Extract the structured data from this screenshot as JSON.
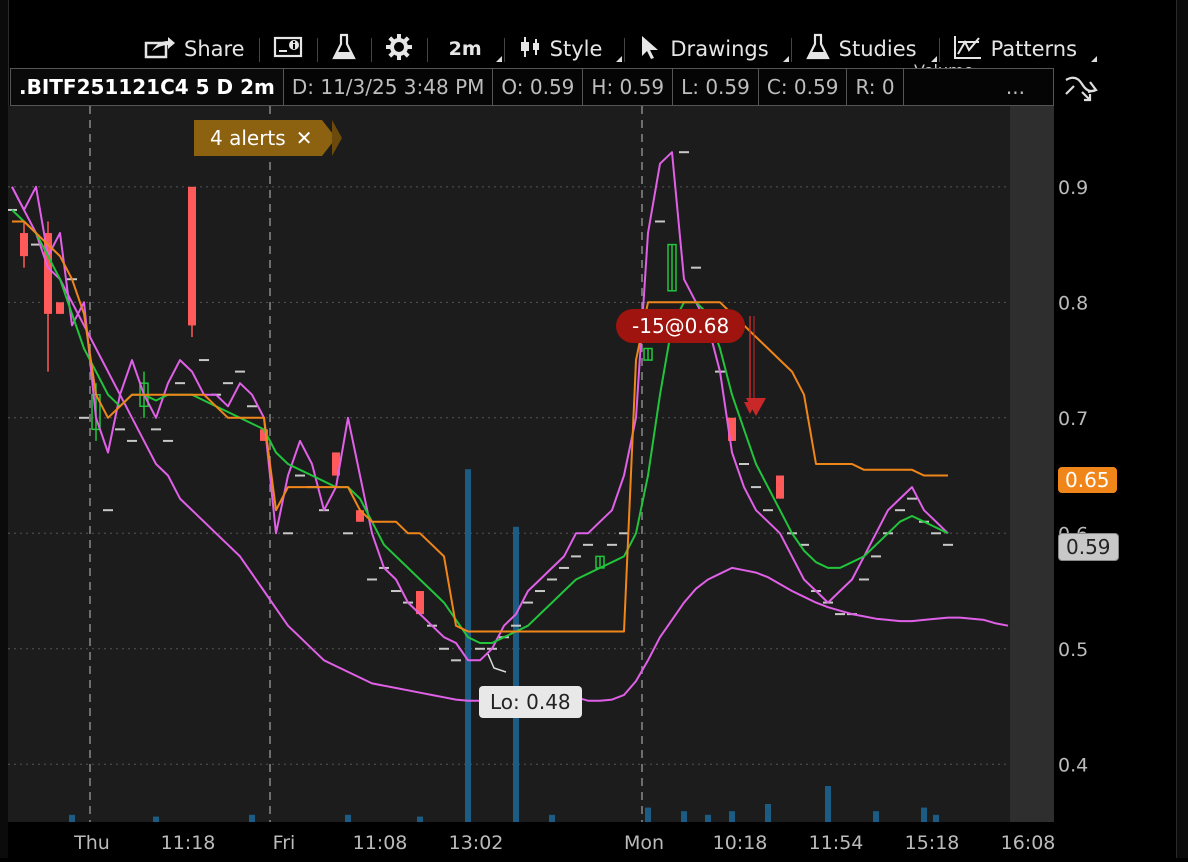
{
  "toolbar": {
    "share": "Share",
    "timeframe": "2m",
    "style": "Style",
    "drawings": "Drawings",
    "studies": "Studies",
    "patterns": "Patterns",
    "volume_overlay": "Volume"
  },
  "infobar": {
    "symbol": ".BITF251121C4 5 D 2m",
    "date": "D: 11/3/25 3:48 PM",
    "open": "O: 0.59",
    "high": "H: 0.59",
    "low": "L: 0.59",
    "close": "C: 0.59",
    "range": "R: 0",
    "more": "..."
  },
  "alerts_label": "4 alerts",
  "order_label": "-15@0.68",
  "lo_label": "Lo: 0.48",
  "price_tags": {
    "high_tag": "0.65",
    "current_tag": "0.59"
  },
  "colors": {
    "background": "#1c1c1c",
    "magenta": "#e060e8",
    "green": "#22c43c",
    "orange": "#f0861a",
    "up_candle": "#22c43c",
    "down_candle": "#ff5a5a",
    "volume": "#1d5c82",
    "alert": "#8c6210",
    "order": "#a0140f"
  },
  "chart_data": {
    "type": "line",
    "title": "",
    "ylim": [
      0.35,
      0.97
    ],
    "y_ticks": [
      0.4,
      0.5,
      0.6,
      0.7,
      0.8,
      0.9
    ],
    "grid": true,
    "x_labels": [
      {
        "label": "Thu",
        "idx": 6
      },
      {
        "label": "11:18",
        "idx": 14
      },
      {
        "label": "Fri",
        "idx": 22
      },
      {
        "label": "11:08",
        "idx": 30
      },
      {
        "label": "13:02",
        "idx": 38
      },
      {
        "label": "Mon",
        "idx": 52
      },
      {
        "label": "10:18",
        "idx": 60
      },
      {
        "label": "11:54",
        "idx": 68
      },
      {
        "label": "15:18",
        "idx": 76
      },
      {
        "label": "16:08",
        "idx": 84
      }
    ],
    "session_breaks": [
      6.5,
      21.5,
      52.5
    ],
    "series": [
      {
        "color_key": "magenta",
        "values": [
          0.9,
          0.88,
          0.86,
          0.83,
          0.82,
          0.8,
          0.78,
          0.76,
          0.74,
          0.72,
          0.7,
          0.68,
          0.66,
          0.65,
          0.63,
          0.62,
          0.61,
          0.6,
          0.59,
          0.58,
          0.565,
          0.55,
          0.535,
          0.52,
          0.51,
          0.5,
          0.49,
          0.485,
          0.48,
          0.475,
          0.47,
          0.468,
          0.466,
          0.464,
          0.462,
          0.46,
          0.458,
          0.456,
          0.455,
          0.455,
          0.456,
          0.458,
          0.46,
          0.462,
          0.463,
          0.462,
          0.46,
          0.458,
          0.455,
          0.455,
          0.456,
          0.46,
          0.472,
          0.49,
          0.51,
          0.525,
          0.54,
          0.552,
          0.56,
          0.565,
          0.57,
          0.568,
          0.566,
          0.562,
          0.556,
          0.55,
          0.545,
          0.54,
          0.536,
          0.533,
          0.53,
          0.528,
          0.526,
          0.525,
          0.524,
          0.524,
          0.525,
          0.526,
          0.527,
          0.527,
          0.526,
          0.525,
          0.522,
          0.52
        ]
      },
      {
        "color_key": "magenta",
        "values": [
          0.9,
          0.88,
          0.9,
          0.84,
          0.86,
          0.78,
          0.8,
          0.7,
          0.67,
          0.72,
          0.75,
          0.72,
          0.7,
          0.73,
          0.75,
          0.74,
          0.72,
          0.72,
          0.71,
          0.73,
          0.72,
          0.7,
          0.6,
          0.65,
          0.68,
          0.66,
          0.62,
          0.64,
          0.7,
          0.65,
          0.6,
          0.57,
          0.56,
          0.54,
          0.53,
          0.52,
          0.51,
          0.505,
          0.49,
          0.49,
          0.5,
          0.52,
          0.53,
          0.55,
          0.56,
          0.57,
          0.58,
          0.6,
          0.6,
          0.61,
          0.62,
          0.65,
          0.7,
          0.86,
          0.92,
          0.93,
          0.82,
          0.8,
          0.78,
          0.74,
          0.67,
          0.64,
          0.62,
          0.61,
          0.6,
          0.58,
          0.56,
          0.55,
          0.54,
          0.55,
          0.56,
          0.58,
          0.6,
          0.62,
          0.63,
          0.64,
          0.62,
          0.61,
          0.6,
          null,
          null,
          null,
          null,
          null
        ]
      },
      {
        "color_key": "green",
        "values": [
          0.88,
          0.87,
          0.86,
          0.84,
          0.82,
          0.79,
          0.76,
          0.74,
          0.72,
          0.71,
          0.72,
          0.72,
          0.715,
          0.72,
          0.72,
          0.72,
          0.715,
          0.71,
          0.705,
          0.7,
          0.695,
          0.69,
          0.67,
          0.66,
          0.655,
          0.65,
          0.645,
          0.64,
          0.64,
          0.63,
          0.61,
          0.59,
          0.58,
          0.57,
          0.56,
          0.55,
          0.54,
          0.525,
          0.51,
          0.505,
          0.505,
          0.51,
          0.515,
          0.52,
          0.53,
          0.54,
          0.55,
          0.56,
          0.565,
          0.57,
          0.575,
          0.58,
          0.6,
          0.65,
          0.72,
          0.78,
          0.8,
          0.8,
          0.79,
          0.76,
          0.72,
          0.69,
          0.66,
          0.64,
          0.62,
          0.6,
          0.585,
          0.575,
          0.57,
          0.57,
          0.575,
          0.58,
          0.59,
          0.6,
          0.61,
          0.615,
          0.61,
          0.605,
          0.6,
          null,
          null,
          null,
          null,
          null
        ]
      },
      {
        "color_key": "orange",
        "values": [
          0.87,
          0.87,
          0.86,
          0.85,
          0.84,
          0.82,
          0.79,
          0.72,
          0.7,
          0.71,
          0.72,
          0.72,
          0.72,
          0.72,
          0.72,
          0.72,
          0.72,
          0.71,
          0.7,
          0.7,
          0.7,
          0.7,
          0.62,
          0.64,
          0.64,
          0.64,
          0.64,
          0.64,
          0.64,
          0.62,
          0.61,
          0.61,
          0.61,
          0.6,
          0.6,
          0.59,
          0.58,
          0.52,
          0.515,
          0.515,
          0.515,
          0.515,
          0.515,
          0.515,
          0.515,
          0.515,
          0.515,
          0.515,
          0.515,
          0.515,
          0.515,
          0.515,
          0.75,
          0.8,
          0.8,
          0.8,
          0.8,
          0.8,
          0.8,
          0.8,
          0.79,
          0.78,
          0.77,
          0.76,
          0.75,
          0.74,
          0.72,
          0.66,
          0.66,
          0.66,
          0.66,
          0.655,
          0.655,
          0.655,
          0.655,
          0.655,
          0.65,
          0.65,
          0.65,
          null,
          null,
          null,
          null,
          null
        ]
      }
    ],
    "candles": [
      {
        "idx": 1,
        "o": 0.86,
        "c": 0.84,
        "h": 0.87,
        "l": 0.83
      },
      {
        "idx": 3,
        "o": 0.86,
        "c": 0.79,
        "h": 0.87,
        "l": 0.74
      },
      {
        "idx": 4,
        "o": 0.8,
        "c": 0.79,
        "h": 0.8,
        "l": 0.79
      },
      {
        "idx": 7,
        "o": 0.69,
        "c": 0.72,
        "h": 0.73,
        "l": 0.68
      },
      {
        "idx": 11,
        "o": 0.71,
        "c": 0.73,
        "h": 0.74,
        "l": 0.7
      },
      {
        "idx": 15,
        "o": 0.9,
        "c": 0.78,
        "h": 0.9,
        "l": 0.77
      },
      {
        "idx": 21,
        "o": 0.69,
        "c": 0.68,
        "h": 0.69,
        "l": 0.68
      },
      {
        "idx": 27,
        "o": 0.67,
        "c": 0.65,
        "h": 0.67,
        "l": 0.65
      },
      {
        "idx": 29,
        "o": 0.62,
        "c": 0.61,
        "h": 0.62,
        "l": 0.61
      },
      {
        "idx": 34,
        "o": 0.55,
        "c": 0.53,
        "h": 0.55,
        "l": 0.53
      },
      {
        "idx": 49,
        "o": 0.57,
        "c": 0.58,
        "h": 0.58,
        "l": 0.57
      },
      {
        "idx": 53,
        "o": 0.75,
        "c": 0.76,
        "h": 0.76,
        "l": 0.75
      },
      {
        "idx": 55,
        "o": 0.81,
        "c": 0.85,
        "h": 0.85,
        "l": 0.81
      },
      {
        "idx": 58,
        "o": 0.79,
        "c": 0.78,
        "h": 0.79,
        "l": 0.78
      },
      {
        "idx": 60,
        "o": 0.7,
        "c": 0.68,
        "h": 0.7,
        "l": 0.68
      },
      {
        "idx": 64,
        "o": 0.65,
        "c": 0.63,
        "h": 0.65,
        "l": 0.63
      }
    ],
    "ticks": [
      {
        "idx": 0,
        "v": 0.88
      },
      {
        "idx": 2,
        "v": 0.85
      },
      {
        "idx": 5,
        "v": 0.82
      },
      {
        "idx": 6,
        "v": 0.7
      },
      {
        "idx": 8,
        "v": 0.62
      },
      {
        "idx": 9,
        "v": 0.69
      },
      {
        "idx": 10,
        "v": 0.68
      },
      {
        "idx": 12,
        "v": 0.69
      },
      {
        "idx": 13,
        "v": 0.68
      },
      {
        "idx": 14,
        "v": 0.73
      },
      {
        "idx": 16,
        "v": 0.75
      },
      {
        "idx": 17,
        "v": 0.72
      },
      {
        "idx": 18,
        "v": 0.73
      },
      {
        "idx": 19,
        "v": 0.74
      },
      {
        "idx": 20,
        "v": 0.71
      },
      {
        "idx": 23,
        "v": 0.6
      },
      {
        "idx": 24,
        "v": 0.65
      },
      {
        "idx": 25,
        "v": 0.64
      },
      {
        "idx": 26,
        "v": 0.62
      },
      {
        "idx": 28,
        "v": 0.6
      },
      {
        "idx": 30,
        "v": 0.56
      },
      {
        "idx": 31,
        "v": 0.57
      },
      {
        "idx": 32,
        "v": 0.55
      },
      {
        "idx": 33,
        "v": 0.54
      },
      {
        "idx": 35,
        "v": 0.52
      },
      {
        "idx": 36,
        "v": 0.5
      },
      {
        "idx": 37,
        "v": 0.49
      },
      {
        "idx": 39,
        "v": 0.5
      },
      {
        "idx": 40,
        "v": 0.5
      },
      {
        "idx": 41,
        "v": 0.51
      },
      {
        "idx": 42,
        "v": 0.52
      },
      {
        "idx": 43,
        "v": 0.54
      },
      {
        "idx": 44,
        "v": 0.55
      },
      {
        "idx": 45,
        "v": 0.56
      },
      {
        "idx": 46,
        "v": 0.57
      },
      {
        "idx": 47,
        "v": 0.58
      },
      {
        "idx": 48,
        "v": 0.59
      },
      {
        "idx": 50,
        "v": 0.59
      },
      {
        "idx": 51,
        "v": 0.6
      },
      {
        "idx": 54,
        "v": 0.87
      },
      {
        "idx": 56,
        "v": 0.93
      },
      {
        "idx": 57,
        "v": 0.83
      },
      {
        "idx": 59,
        "v": 0.74
      },
      {
        "idx": 61,
        "v": 0.66
      },
      {
        "idx": 62,
        "v": 0.64
      },
      {
        "idx": 63,
        "v": 0.62
      },
      {
        "idx": 65,
        "v": 0.6
      },
      {
        "idx": 66,
        "v": 0.59
      },
      {
        "idx": 67,
        "v": 0.55
      },
      {
        "idx": 68,
        "v": 0.54
      },
      {
        "idx": 69,
        "v": 0.53
      },
      {
        "idx": 70,
        "v": 0.53
      },
      {
        "idx": 71,
        "v": 0.56
      },
      {
        "idx": 72,
        "v": 0.58
      },
      {
        "idx": 73,
        "v": 0.6
      },
      {
        "idx": 74,
        "v": 0.62
      },
      {
        "idx": 75,
        "v": 0.63
      },
      {
        "idx": 76,
        "v": 0.61
      },
      {
        "idx": 77,
        "v": 0.6
      },
      {
        "idx": 78,
        "v": 0.59
      }
    ],
    "volume": [
      {
        "idx": 5,
        "v": 0.02
      },
      {
        "idx": 12,
        "v": 0.015
      },
      {
        "idx": 20,
        "v": 0.02
      },
      {
        "idx": 28,
        "v": 0.02
      },
      {
        "idx": 34,
        "v": 0.015
      },
      {
        "idx": 38,
        "v": 0.98
      },
      {
        "idx": 42,
        "v": 0.82
      },
      {
        "idx": 45,
        "v": 0.02
      },
      {
        "idx": 53,
        "v": 0.04
      },
      {
        "idx": 56,
        "v": 0.03
      },
      {
        "idx": 58,
        "v": 0.02
      },
      {
        "idx": 60,
        "v": 0.03
      },
      {
        "idx": 63,
        "v": 0.05
      },
      {
        "idx": 68,
        "v": 0.1
      },
      {
        "idx": 72,
        "v": 0.03
      },
      {
        "idx": 76,
        "v": 0.04
      },
      {
        "idx": 77,
        "v": 0.02
      }
    ]
  }
}
